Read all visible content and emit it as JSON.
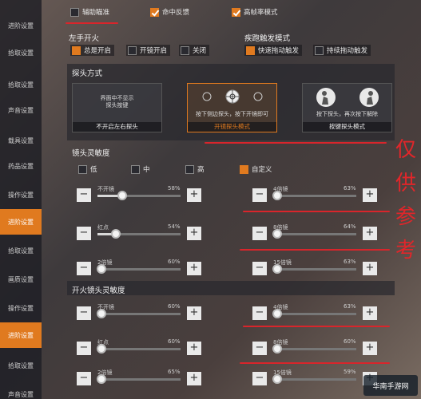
{
  "sidebar": {
    "items": [
      {
        "label": "进阶设置",
        "active": false
      },
      {
        "label": "拾取设置",
        "active": false
      },
      {
        "label": "拾取设置",
        "active": false
      },
      {
        "label": "声音设置",
        "active": false
      },
      {
        "label": "载具设置",
        "active": false
      },
      {
        "label": "药品设置",
        "active": false
      },
      {
        "label": "操作设置",
        "active": false
      },
      {
        "label": "进阶设置",
        "active": true
      },
      {
        "label": "拾取设置",
        "active": false
      },
      {
        "label": "画质设置",
        "active": false
      },
      {
        "label": "操作设置",
        "active": false
      },
      {
        "label": "进阶设置",
        "active": true
      },
      {
        "label": "拾取设置",
        "active": false
      },
      {
        "label": "声音设置",
        "active": false
      }
    ]
  },
  "top_options": [
    {
      "label": "辅助瞄准",
      "checked": false
    },
    {
      "label": "命中反馈",
      "checked": true
    },
    {
      "label": "高帧率模式",
      "checked": true
    }
  ],
  "left_fire": {
    "title": "左手开火",
    "options": [
      {
        "label": "总是开启",
        "checked": true
      },
      {
        "label": "开镜开启",
        "checked": false
      },
      {
        "label": "关闭",
        "checked": false
      }
    ]
  },
  "sprint": {
    "title": "疾跑触发模式",
    "options": [
      {
        "label": "快速拖动触发",
        "checked": true
      },
      {
        "label": "持续拖动触发",
        "checked": false
      }
    ]
  },
  "peek": {
    "title": "探头方式",
    "cards": [
      {
        "desc": "界面中不显示\n探头按键",
        "name": "不开启左右探头",
        "selected": false
      },
      {
        "desc": "按下侧边探头，按下开镜即可",
        "name": "开镜探头模式",
        "selected": true
      },
      {
        "desc": "按下探头，再次按下解除",
        "name": "按键探头模式",
        "selected": false
      }
    ]
  },
  "scope_sens": {
    "title": "镜头灵敏度",
    "presets": [
      {
        "label": "低",
        "checked": false
      },
      {
        "label": "中",
        "checked": false
      },
      {
        "label": "高",
        "checked": false
      },
      {
        "label": "自定义",
        "checked": true
      }
    ],
    "sliders": [
      {
        "label": "不开镜",
        "value": "58%",
        "level": 0.3
      },
      {
        "label": "4倍镜",
        "value": "63%",
        "level": 0.05
      },
      {
        "label": "红点",
        "value": "54%",
        "level": 0.22
      },
      {
        "label": "8倍镜",
        "value": "64%",
        "level": 0.05
      },
      {
        "label": "2倍镜",
        "value": "60%",
        "level": 0.05
      },
      {
        "label": "15倍镜",
        "value": "63%",
        "level": 0.05
      }
    ]
  },
  "fire_sens": {
    "title": "开火镜头灵敏度",
    "sliders": [
      {
        "label": "不开镜",
        "value": "60%",
        "level": 0.05
      },
      {
        "label": "4倍镜",
        "value": "63%",
        "level": 0.05
      },
      {
        "label": "红点",
        "value": "60%",
        "level": 0.05
      },
      {
        "label": "8倍镜",
        "value": "60%",
        "level": 0.05
      },
      {
        "label": "2倍镜",
        "value": "65%",
        "level": 0.05
      },
      {
        "label": "15倍镜",
        "value": "59%",
        "level": 0.05
      }
    ]
  },
  "watermark": {
    "chars": [
      "仅",
      "供",
      "参",
      "考"
    ]
  },
  "logo": {
    "text": "华南手游网"
  },
  "colors": {
    "accent": "#e07a1f",
    "annotation": "#d9252b"
  }
}
